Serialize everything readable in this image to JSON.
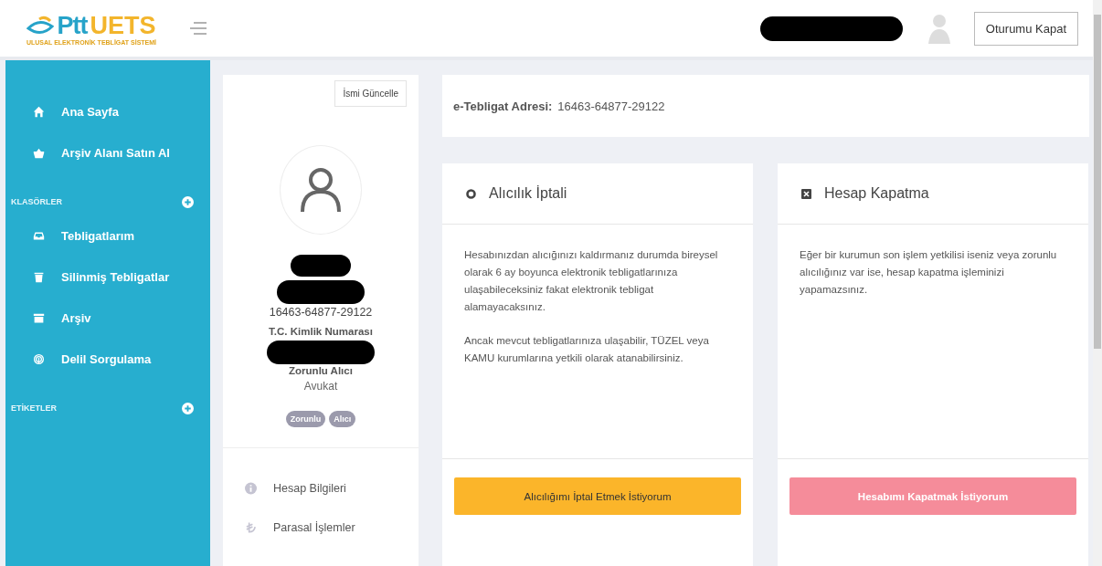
{
  "header": {
    "logo": {
      "brand_a": "Ptt",
      "brand_b": "UETS",
      "tagline": "ULUSAL ELEKTRONİK TEBLİGAT SİSTEMİ"
    },
    "logout": "Oturumu Kapat"
  },
  "sidebar": {
    "groups": [
      {
        "items": [
          {
            "label": "Ana Sayfa"
          },
          {
            "label": "Arşiv Alanı Satın Al"
          }
        ]
      },
      {
        "title": "KLASÖRLER",
        "items": [
          {
            "label": "Tebligatlarım"
          },
          {
            "label": "Silinmiş Tebligatlar"
          },
          {
            "label": "Arşiv"
          },
          {
            "label": "Delil Sorgulama"
          }
        ]
      },
      {
        "title": "ETİKETLER"
      }
    ]
  },
  "profile": {
    "update_button": "İsmi Güncelle",
    "id": "16463-64877-29122",
    "id_label": "T.C. Kimlik Numarası",
    "role": "Zorunlu Alıcı",
    "title": "Avukat",
    "badges": [
      "Zorunlu",
      "Alıcı"
    ],
    "menu": [
      {
        "label": "Hesap Bilgileri"
      },
      {
        "label": "Parasal İşlemler"
      }
    ]
  },
  "address": {
    "label": "e-Tebligat Adresi:",
    "value": "16463-64877-29122"
  },
  "cards": [
    {
      "kind": "warning",
      "title": "Alıcılık İptali",
      "paragraphs": [
        "Hesabınızdan alıcığınızı kaldırmanız durumda bireysel olarak 6 ay boyunca elektronik tebligatlarınıza ulaşabileceksiniz fakat elektronik tebligat alamayacaksınız.",
        "Ancak mevcut tebligatlarınıza ulaşabilir, TÜZEL veya KAMU kurumlarına yetkili olarak atanabilirsiniz."
      ],
      "button": "Alıcılığımı İptal Etmek İstiyorum"
    },
    {
      "kind": "danger",
      "title": "Hesap Kapatma",
      "paragraphs": [
        "Eğer bir kurumun son işlem yetkilisi iseniz veya zorunlu alıcılığınız var ise, hesap kapatma işleminizi yapamazsınız."
      ],
      "button": "Hesabımı Kapatmak İstiyorum"
    }
  ]
}
